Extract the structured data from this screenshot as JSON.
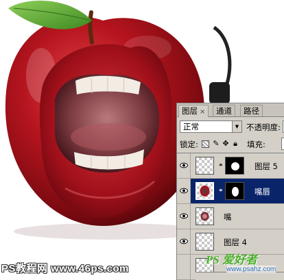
{
  "canvas": {
    "artwork_description_icon": "apple-with-lips-artwork"
  },
  "layers_panel": {
    "tabs": [
      {
        "label": "图层",
        "close": "×",
        "active": true
      },
      {
        "label": "通道",
        "active": false
      },
      {
        "label": "路径",
        "active": false
      }
    ],
    "blend_mode": "正常",
    "opacity_label": "不透明度:",
    "lock_label": "锁定:",
    "fill_label": "填充:",
    "lock_icons": [
      "lock-transparent-icon",
      "lock-brush-icon",
      "lock-move-icon",
      "lock-all-icon"
    ],
    "layers": [
      {
        "name": "图层 5",
        "visible": true,
        "selected": false,
        "has_mask": true,
        "thumb": "transparent"
      },
      {
        "name": "嘴唇",
        "visible": true,
        "selected": true,
        "has_mask": true,
        "thumb": "lips"
      },
      {
        "name": "嘴",
        "visible": true,
        "selected": false,
        "has_mask": false,
        "thumb": "mouth"
      },
      {
        "name": "图层 4",
        "visible": true,
        "selected": false,
        "has_mask": false,
        "thumb": "transparent"
      }
    ]
  },
  "watermarks": {
    "left": "PS教程网 www.46ps.com",
    "right_logo": "PS 爱好者",
    "right_url": "www.psahz.com"
  },
  "colors": {
    "panel_bg": "#d4d0c8",
    "selection": "#0a246a",
    "apple_red": "#b0121c"
  }
}
